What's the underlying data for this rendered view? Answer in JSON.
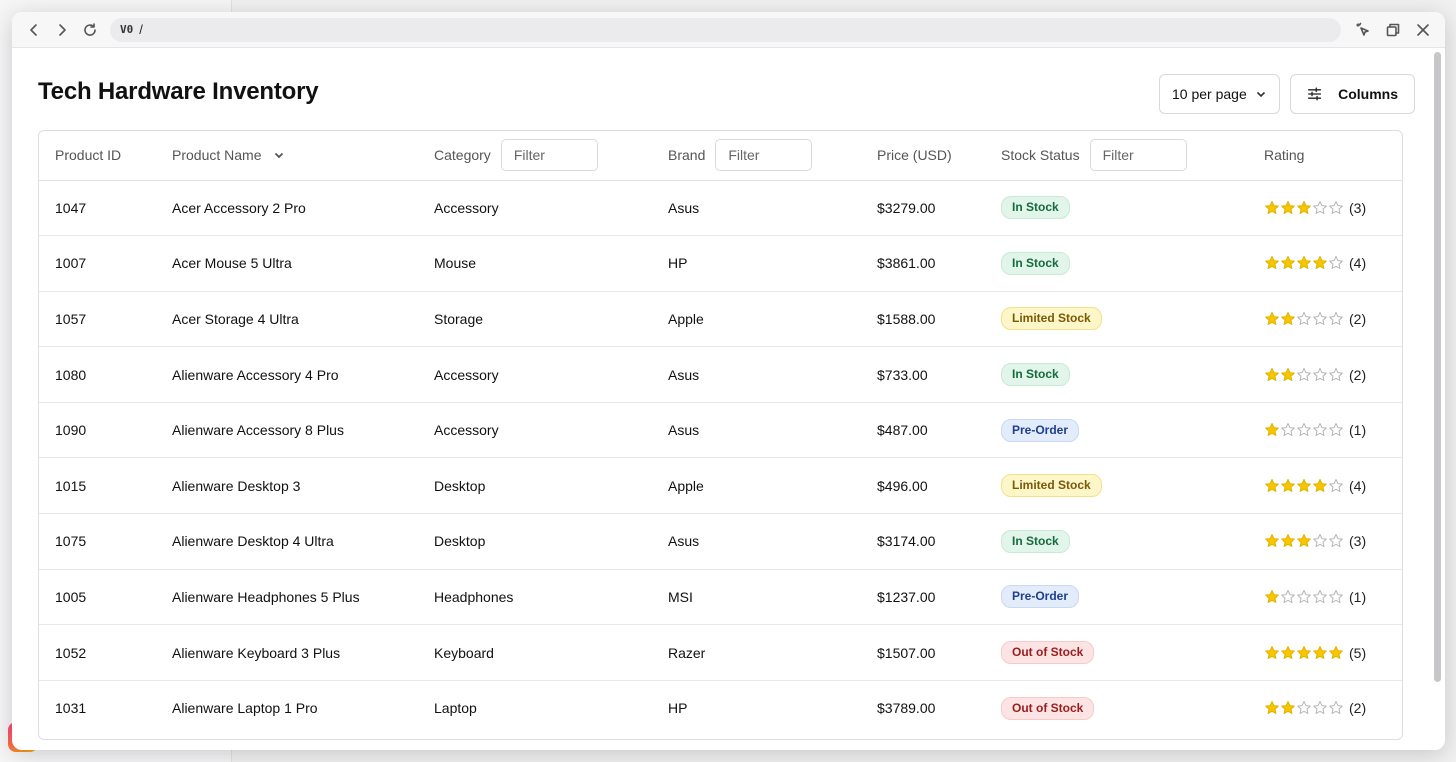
{
  "browser": {
    "url_logo": "V0",
    "url_text": "/"
  },
  "page": {
    "title": "Tech Hardware Inventory",
    "per_page_label": "10 per page",
    "columns_label": "Columns"
  },
  "table": {
    "headers": {
      "product_id": "Product ID",
      "product_name": "Product Name",
      "category": "Category",
      "brand": "Brand",
      "price": "Price (USD)",
      "stock_status": "Stock Status",
      "rating": "Rating"
    },
    "filter_placeholder": "Filter",
    "rows": [
      {
        "id": "1047",
        "name": "Acer Accessory 2 Pro",
        "category": "Accessory",
        "brand": "Asus",
        "price": "$3279.00",
        "status": "In Stock",
        "status_type": "in",
        "rating": 3,
        "rating_label": "(3)"
      },
      {
        "id": "1007",
        "name": "Acer Mouse 5 Ultra",
        "category": "Mouse",
        "brand": "HP",
        "price": "$3861.00",
        "status": "In Stock",
        "status_type": "in",
        "rating": 4,
        "rating_label": "(4)"
      },
      {
        "id": "1057",
        "name": "Acer Storage 4 Ultra",
        "category": "Storage",
        "brand": "Apple",
        "price": "$1588.00",
        "status": "Limited Stock",
        "status_type": "lim",
        "rating": 2,
        "rating_label": "(2)"
      },
      {
        "id": "1080",
        "name": "Alienware Accessory 4 Pro",
        "category": "Accessory",
        "brand": "Asus",
        "price": "$733.00",
        "status": "In Stock",
        "status_type": "in",
        "rating": 2,
        "rating_label": "(2)"
      },
      {
        "id": "1090",
        "name": "Alienware Accessory 8 Plus",
        "category": "Accessory",
        "brand": "Asus",
        "price": "$487.00",
        "status": "Pre-Order",
        "status_type": "pre",
        "rating": 1,
        "rating_label": "(1)"
      },
      {
        "id": "1015",
        "name": "Alienware Desktop 3",
        "category": "Desktop",
        "brand": "Apple",
        "price": "$496.00",
        "status": "Limited Stock",
        "status_type": "lim",
        "rating": 4,
        "rating_label": "(4)"
      },
      {
        "id": "1075",
        "name": "Alienware Desktop 4 Ultra",
        "category": "Desktop",
        "brand": "Asus",
        "price": "$3174.00",
        "status": "In Stock",
        "status_type": "in",
        "rating": 3,
        "rating_label": "(3)"
      },
      {
        "id": "1005",
        "name": "Alienware Headphones 5 Plus",
        "category": "Headphones",
        "brand": "MSI",
        "price": "$1237.00",
        "status": "Pre-Order",
        "status_type": "pre",
        "rating": 1,
        "rating_label": "(1)"
      },
      {
        "id": "1052",
        "name": "Alienware Keyboard 3 Plus",
        "category": "Keyboard",
        "brand": "Razer",
        "price": "$1507.00",
        "status": "Out of Stock",
        "status_type": "out",
        "rating": 5,
        "rating_label": "(5)"
      },
      {
        "id": "1031",
        "name": "Alienware Laptop 1 Pro",
        "category": "Laptop",
        "brand": "HP",
        "price": "$3789.00",
        "status": "Out of Stock",
        "status_type": "out",
        "rating": 2,
        "rating_label": "(2)"
      }
    ]
  },
  "status_colors": {
    "in": "#e2f5ea",
    "lim": "#fdf6c8",
    "pre": "#e2ecfb",
    "out": "#fde4e4"
  },
  "star_color": "#f7c600",
  "max_rating": 5
}
